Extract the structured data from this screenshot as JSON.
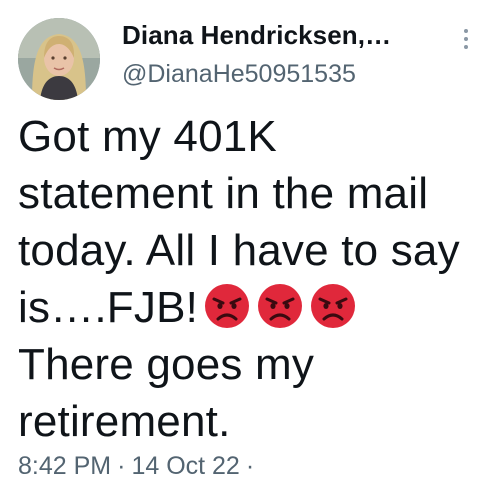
{
  "author": {
    "display_name": "Diana Hendricksen,…",
    "handle": "@DianaHe50951535"
  },
  "tweet": {
    "line1": "Got my 401K",
    "line2": "statement in the mail",
    "line3": "today. All I have to say",
    "line4": "is….FJB!",
    "line5": "There goes my",
    "line6": "retirement.",
    "emojis": [
      "angry-face-emoji",
      "angry-face-emoji",
      "angry-face-emoji"
    ]
  },
  "meta": {
    "time": "8:42 PM",
    "separator": "·",
    "date": "14 Oct 22",
    "trailing_separator": "·"
  },
  "colors": {
    "text": "#0f1419",
    "secondary": "#536471",
    "emoji_red": "#e0283b"
  },
  "icons": {
    "more": "more-vertical-icon",
    "avatar": "profile-avatar"
  }
}
